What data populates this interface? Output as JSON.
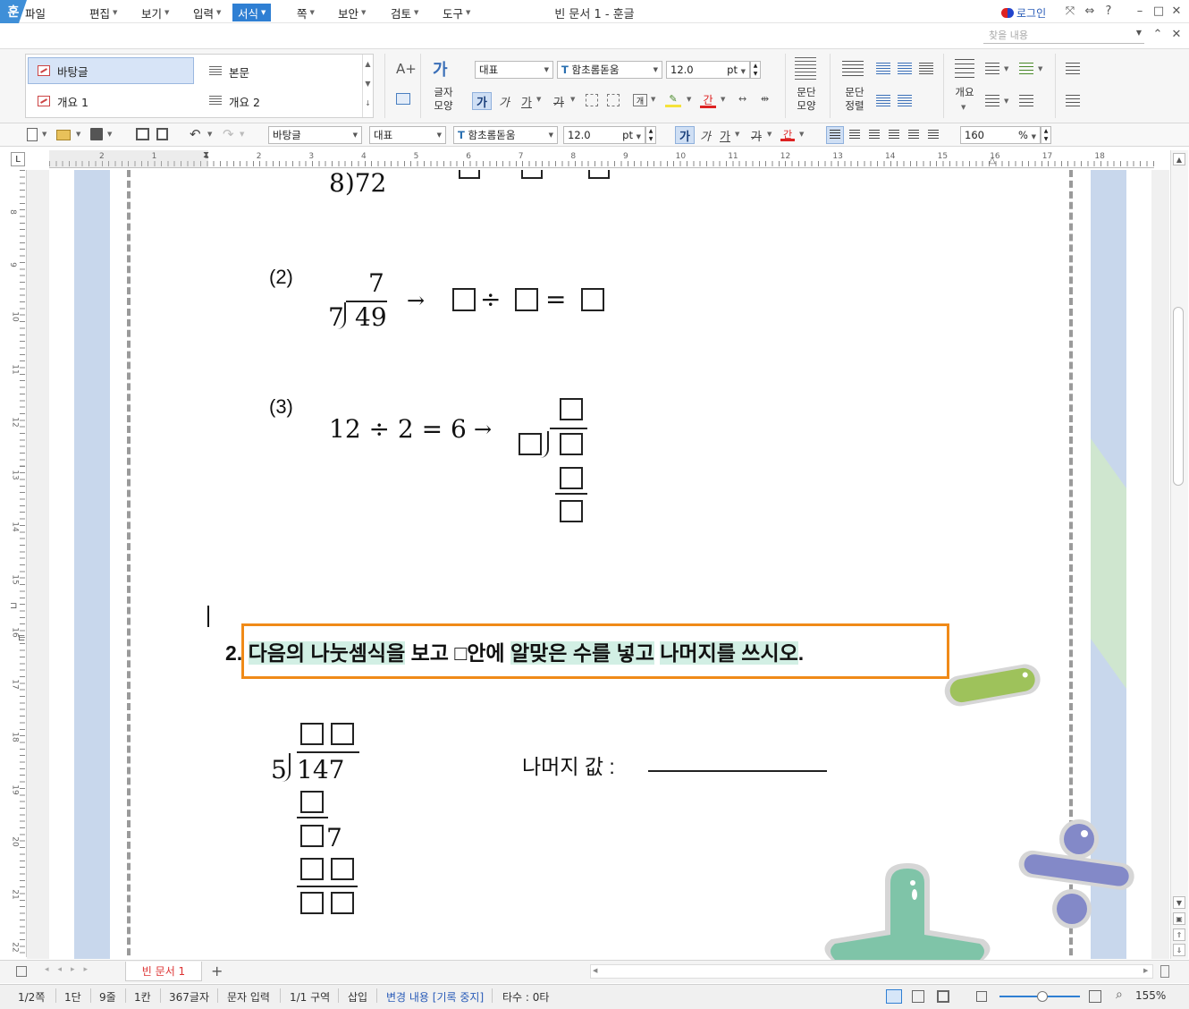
{
  "window": {
    "title": "빈 문서 1 - 훈글",
    "app_logo": "훈",
    "login_label": "로그인"
  },
  "menu": {
    "items": [
      "파일",
      "편집",
      "보기",
      "입력",
      "서식",
      "쪽",
      "보안",
      "검토",
      "도구"
    ],
    "active": "서식",
    "search_placeholder": "찾을 내용"
  },
  "ribbon": {
    "styles": [
      "바탕글",
      "본문",
      "개요 1",
      "개요 2"
    ],
    "font_lang": "대표",
    "font_name": "함초롬돋움",
    "font_size": "12.0",
    "unit": "pt",
    "char_shape_label": "글자\n모양",
    "para_shape_label": "문단\n모양",
    "para_align_label": "문단\n정렬",
    "outline_label": "개요",
    "bold_glyph": "가",
    "italic_glyph": "가",
    "underline_glyph": "가",
    "strike_glyph": "가",
    "color_glyph": "간"
  },
  "toolbar2": {
    "style": "바탕글",
    "font_lang": "대표",
    "font_name": "함초롬돋움",
    "font_size": "12.0",
    "unit": "pt",
    "zoom_value": "160",
    "zoom_unit": "%"
  },
  "ruler": {
    "h_ticks": [
      "2",
      "1",
      "1",
      "2",
      "3",
      "4",
      "5",
      "6",
      "7",
      "8",
      "9",
      "10",
      "11",
      "12",
      "13",
      "14",
      "15",
      "16",
      "17",
      "18"
    ],
    "v_ticks": [
      "8",
      "9",
      "10",
      "11",
      "12",
      "13",
      "14",
      "15",
      "16",
      "17",
      "18",
      "19",
      "20",
      "21",
      "22"
    ]
  },
  "document": {
    "p1_partial": "8)72",
    "q1_2": {
      "label": "(2)",
      "quotient": "7",
      "divisor": "7",
      "dividend": "49",
      "arrow": "→",
      "div_sign": "÷",
      "eq_sign": "="
    },
    "q1_3": {
      "label": "(3)",
      "expr": "12 ÷ 2 = 6",
      "arrow": "→"
    },
    "q2": {
      "number": "2.",
      "text_parts": [
        "다음의 나눗셈식을",
        " 보고 □안에 ",
        "알맞은 수를 넣고",
        " ",
        "나머지를 쓰시오",
        "."
      ]
    },
    "long_div": {
      "divisor": "5",
      "dividend": "147",
      "seven": "7"
    },
    "remainder_label": "나머지 값 :"
  },
  "tabs": {
    "doc_tab": "빈 문서 1",
    "add": "+"
  },
  "status": {
    "page": "1/2쪽",
    "column": "1단",
    "line": "9줄",
    "cell": "1칸",
    "chars": "367글자",
    "mode": "문자 입력",
    "section": "1/1 구역",
    "insert": "삽입",
    "track": "변경 내용 [기록 중지]",
    "typing": "타수 : 0타",
    "zoom": "155%"
  },
  "colors": {
    "accent": "#2f7fd3",
    "highlight_frame": "#f08a18",
    "text_highlight": "#d2efe4",
    "tab_text": "#dd3333"
  }
}
